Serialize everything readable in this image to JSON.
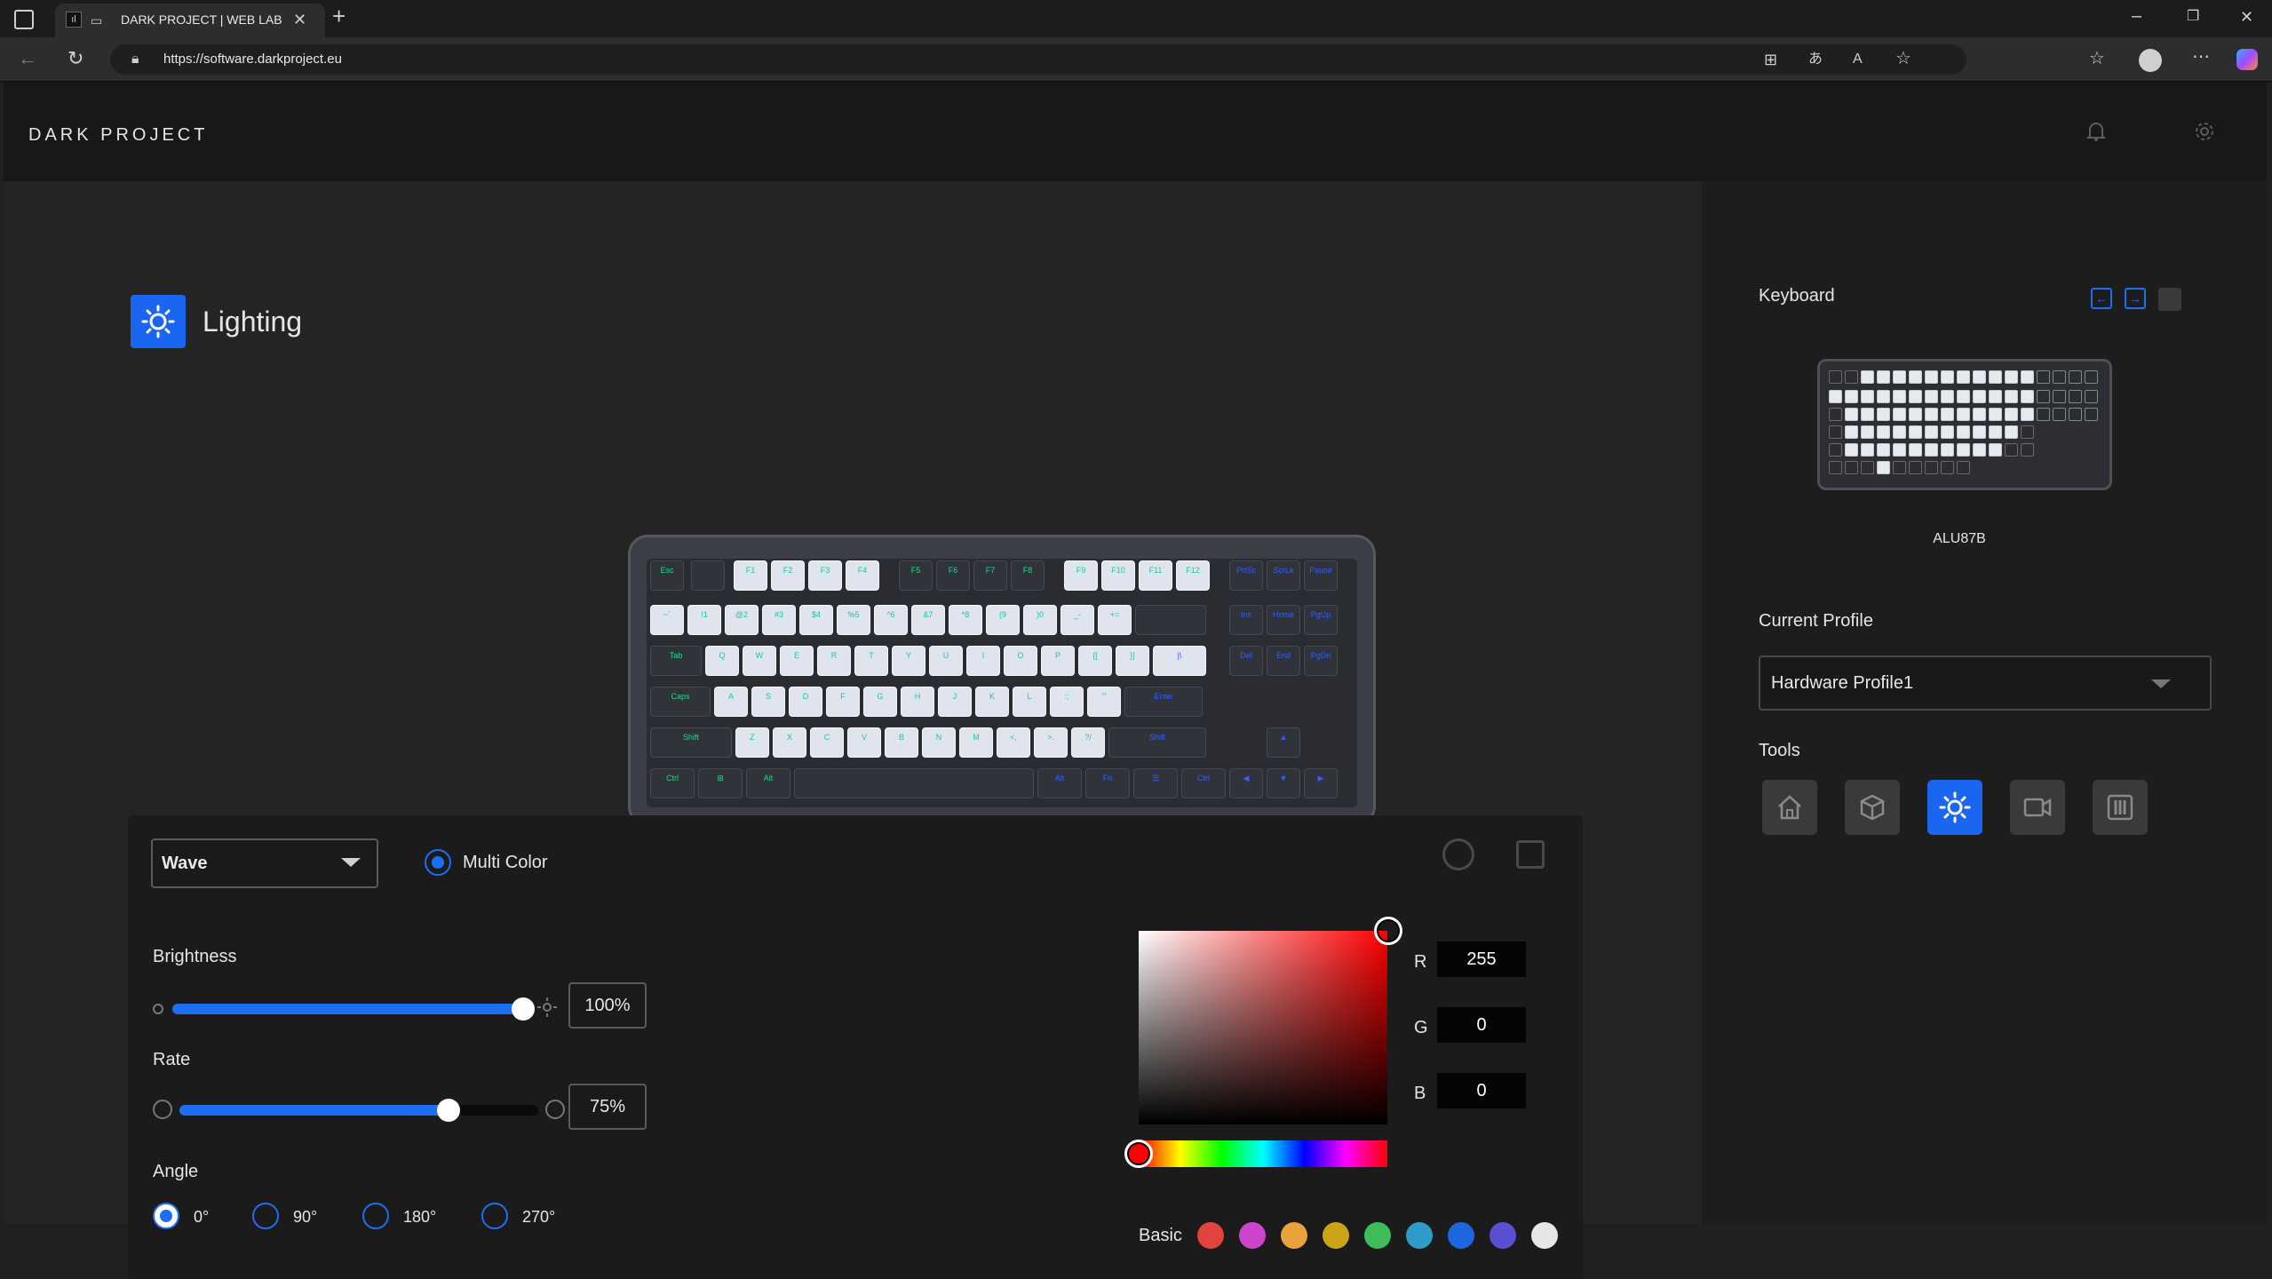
{
  "browser": {
    "tab_title": "DARK PROJECT | WEB LAB",
    "url": "https://software.darkproject.eu"
  },
  "app": {
    "brand": "DARK PROJECT",
    "section_title": "Lighting"
  },
  "lighting": {
    "effect_value": "Wave",
    "multi_color_label": "Multi Color",
    "brightness_label": "Brightness",
    "brightness_value": "100%",
    "brightness_level": 1.0,
    "rate_label": "Rate",
    "rate_value": "75%",
    "rate_level": 0.75,
    "angle_label": "Angle",
    "angles": [
      "0°",
      "90°",
      "180°",
      "270°"
    ],
    "angle_selected": "0°"
  },
  "color_picker": {
    "r_label": "R",
    "g_label": "G",
    "b_label": "B",
    "r": "255",
    "g": "0",
    "b": "0",
    "basic_label": "Basic",
    "basic_colors": [
      "#e2433d",
      "#cc44cc",
      "#e8a33a",
      "#c9a416",
      "#3cbd5a",
      "#2f9bc9",
      "#1e66e0",
      "#5a4fd0",
      "#e6e6e6"
    ],
    "hue": "#ff0000"
  },
  "sidebar": {
    "keyboard_label": "Keyboard",
    "device_name": "ALU87B",
    "current_profile_label": "Current Profile",
    "profile_value": "Hardware Profile1",
    "tools_label": "Tools",
    "tools": [
      "home-icon",
      "cube-icon",
      "sun-icon",
      "macro-icon",
      "equalizer-icon"
    ],
    "active_tool": "sun-icon"
  },
  "keyboard": {
    "row_fn": [
      "Esc",
      "",
      "F1",
      "F2",
      "F3",
      "F4",
      "F5",
      "F6",
      "F7",
      "F8",
      "F9",
      "F10",
      "F11",
      "F12",
      "PrtSc",
      "ScrLk",
      "Pause"
    ],
    "row_num": [
      "~`",
      "!1",
      "@2",
      "#3",
      "$4",
      "%5",
      "^6",
      "&7",
      "*8",
      "(9",
      ")0",
      "_-",
      "+=",
      "",
      "Ins",
      "Home",
      "PgUp"
    ],
    "row_q": [
      "Tab",
      "Q",
      "W",
      "E",
      "R",
      "T",
      "Y",
      "U",
      "I",
      "O",
      "P",
      "{[",
      "}]",
      "|\\",
      "Del",
      "End",
      "PgDn"
    ],
    "row_a": [
      "Caps",
      "A",
      "S",
      "D",
      "F",
      "G",
      "H",
      "J",
      "K",
      "L",
      ":;",
      "\"'",
      "Enter"
    ],
    "row_z": [
      "Shift",
      "Z",
      "X",
      "C",
      "V",
      "B",
      "N",
      "M",
      "<,",
      ">.",
      "?/",
      "Shift",
      "▲"
    ],
    "row_ctrl": [
      "Ctrl",
      "⊞",
      "Alt",
      "",
      "Alt",
      "Fn",
      "☰",
      "Ctrl",
      "◀",
      "▼",
      "▶"
    ]
  }
}
